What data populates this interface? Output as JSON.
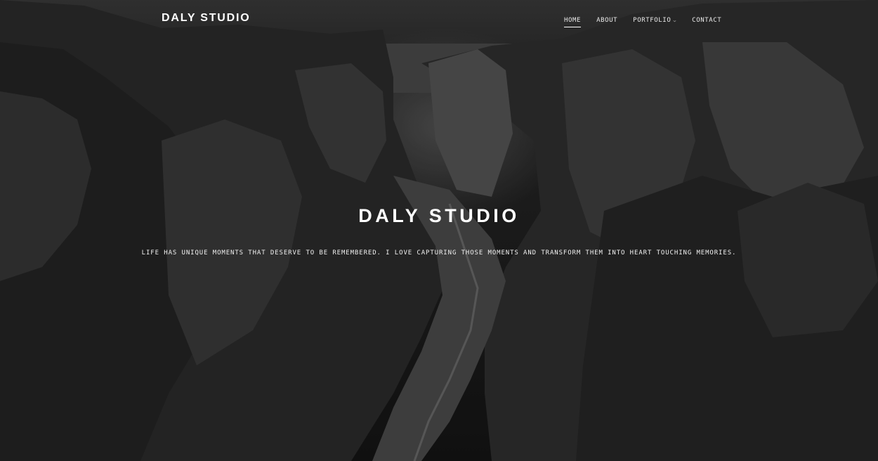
{
  "header": {
    "logo": "DALY STUDIO",
    "nav": [
      {
        "label": "HOME",
        "active": true
      },
      {
        "label": "ABOUT",
        "active": false
      },
      {
        "label": "PORTFOLIO",
        "active": false,
        "has_dropdown": true
      },
      {
        "label": "CONTACT",
        "active": false
      }
    ],
    "dropdown_icon": "chevron-down-icon"
  },
  "hero": {
    "title": "DALY STUDIO",
    "tagline": "LIFE HAS UNIQUE MOMENTS THAT DESERVE TO BE REMEMBERED. I LOVE CAPTURING THOSE MOMENTS AND TRANSFORM THEM INTO HEART TOUCHING MEMORIES.",
    "background": "black-and-white canyon landscape photo"
  },
  "colors": {
    "text": "#ffffff",
    "background": "#1c1c1c"
  }
}
